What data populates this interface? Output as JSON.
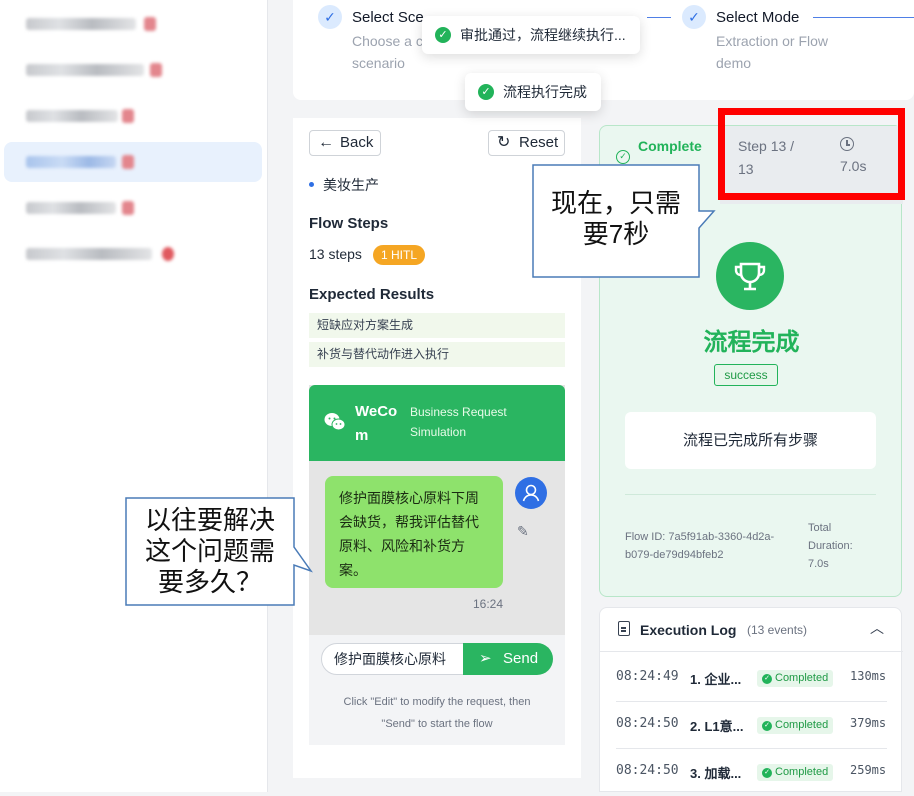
{
  "stepper": {
    "step1_title": "Select Sce",
    "step1_sub_line1": "Choose a c",
    "step1_sub_line2": "scenario",
    "step2_title": "Select Mode",
    "step2_sub_line1": "Extraction or Flow",
    "step2_sub_line2": "demo"
  },
  "toasts": {
    "approval": "审批通过，流程继续执行...",
    "done": "流程执行完成"
  },
  "left_panel": {
    "back_label": "Back",
    "reset_label": "Reset",
    "industry": "美妆生产",
    "flow_steps_title": "Flow Steps",
    "steps_count": "13 steps",
    "hitl_badge": "1 HITL",
    "expected_title": "Expected Results",
    "expected": [
      "短缺应对方案生成",
      "补货与替代动作进入执行"
    ]
  },
  "chat": {
    "app_name_line1": "WeCo",
    "app_name_line2": "m",
    "subtitle_line1": "Business Request",
    "subtitle_line2": "Simulation",
    "message": "修护面膜核心原料下周会缺货，帮我评估替代原料、风险和补货方案。",
    "time": "16:24",
    "input_value": "修护面膜核心原料",
    "send_label": "Send",
    "hint_line1": "Click \"Edit\" to modify the request, then",
    "hint_line2": "\"Send\" to start the flow"
  },
  "result": {
    "status_label": "Complete",
    "step_label_line1": "Step 13 /",
    "step_label_line2": "13",
    "duration": "7.0s",
    "heading": "流程完成",
    "success_badge": "success",
    "message": "流程已完成所有步骤",
    "flow_id_line1": "Flow ID: 7a5f91ab-3360-4d2a-",
    "flow_id_line2": "b079-de79d94bfeb2",
    "total_label_line1": "Total",
    "total_label_line2": "Duration:",
    "total_value": "7.0s"
  },
  "log": {
    "title": "Execution Log",
    "count": "(13 events)",
    "rows": [
      {
        "time": "08:24:49",
        "name": "1. 企业...",
        "status": "Completed",
        "ms": "130ms"
      },
      {
        "time": "08:24:50",
        "name": "2. L1意...",
        "status": "Completed",
        "ms": "379ms"
      },
      {
        "time": "08:24:50",
        "name": "3. 加载...",
        "status": "Completed",
        "ms": "259ms"
      }
    ]
  },
  "callouts": {
    "now_line1": "现在，只需",
    "now_line2": "要7秒",
    "before_line1": "以往要解决",
    "before_line2": "这个问题需",
    "before_line3": "要多久？"
  },
  "colors": {
    "primary_blue": "#2f6fe4",
    "wecom_green": "#2ab561",
    "success_green": "#22b35a",
    "highlight_red": "#ff0000",
    "hitl_orange": "#f5a623"
  }
}
